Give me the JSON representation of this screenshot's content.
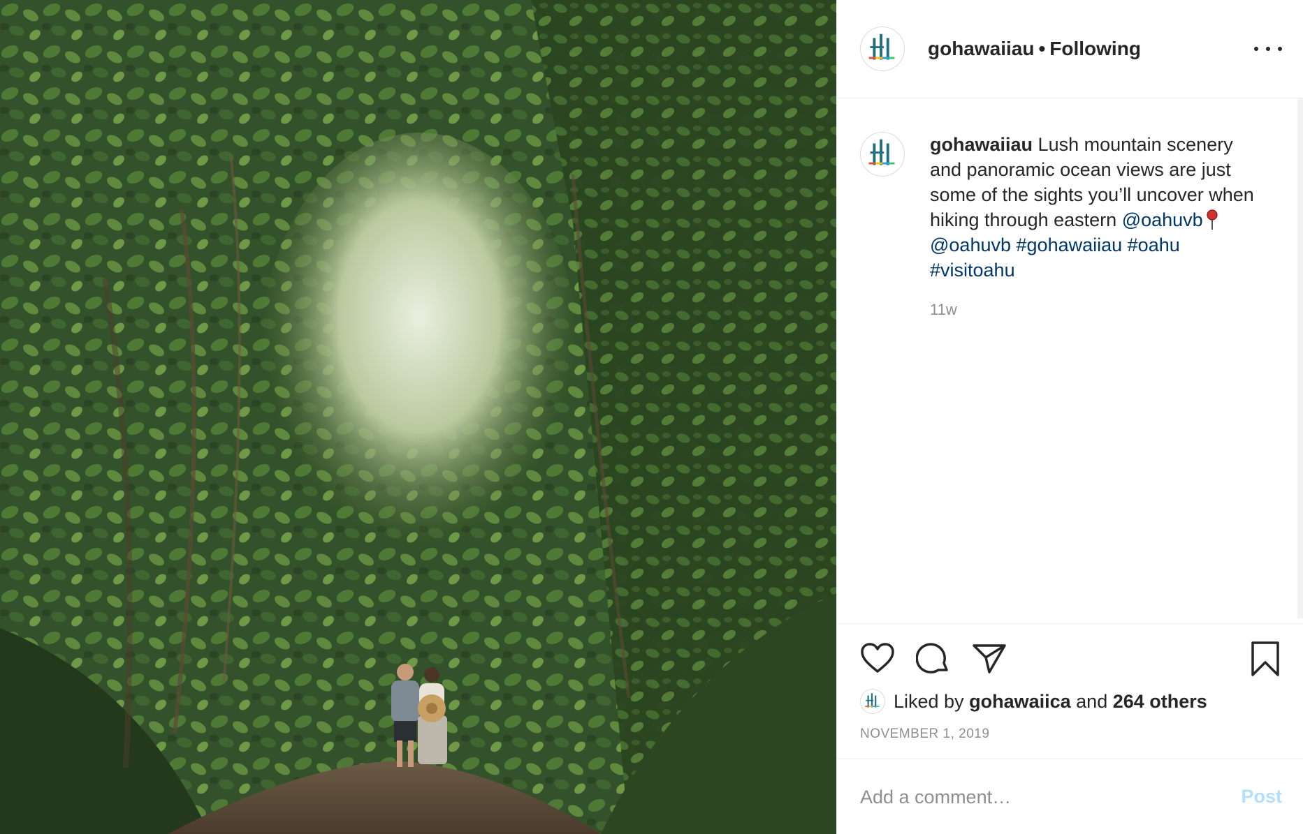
{
  "post": {
    "username": "gohawaiiau",
    "follow_separator": "•",
    "follow_status": "Following",
    "more_icon": "more-options-icon",
    "image_alt": "Couple walking along a forest trail under a canopy of lush green vines"
  },
  "caption": {
    "username": "gohawaiiau",
    "text": "Lush mountain scenery and panoramic ocean views are just some of the sights you’ll uncover when hiking through eastern",
    "mention1": "@oahuvb",
    "pin_icon": "round-pushpin-icon",
    "mention2": "@oahuvb",
    "hashtag1": "#gohawaiiau",
    "hashtag2": "#oahu",
    "hashtag3": "#visitoahu",
    "time_ago": "11w"
  },
  "actions": {
    "like_icon": "heart-icon",
    "comment_icon": "comment-icon",
    "share_icon": "paper-plane-icon",
    "save_icon": "bookmark-icon"
  },
  "likes": {
    "prefix": "Liked by",
    "liker": "gohawaiica",
    "middle": "and",
    "others": "264 others"
  },
  "date": "NOVEMBER 1, 2019",
  "comment": {
    "placeholder": "Add a comment…",
    "post_label": "Post"
  },
  "colors": {
    "link": "#00376b",
    "post_disabled": "#b2dffc",
    "muted": "#8e8e8e",
    "text": "#262626"
  }
}
